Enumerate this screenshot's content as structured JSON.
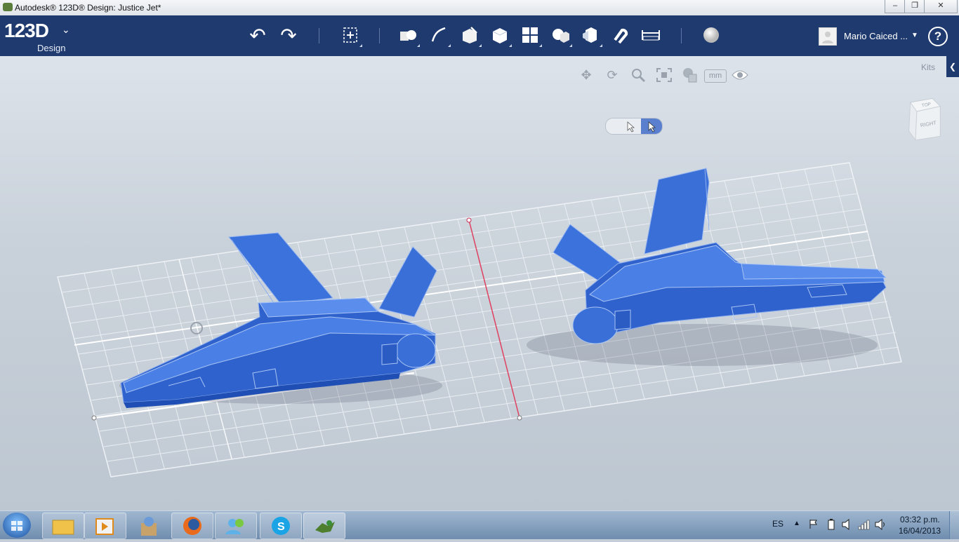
{
  "window": {
    "title": "Autodesk® 123D® Design: Justice Jet*",
    "controls": [
      "–",
      "❐",
      "✕"
    ]
  },
  "toolbar": {
    "logo_main": "123D",
    "logo_sub": "Design",
    "logo_chevron": "⌄",
    "undo_icon": "↶",
    "redo_icon": "↷",
    "user_name": "Mario Caiced ...",
    "user_dropdown": "▼",
    "help": "?"
  },
  "viewport": {
    "units": "mm",
    "kits_label": "Kits",
    "kits_tab_icon": "❮",
    "viewcube_top": "TOP",
    "viewcube_right": "RIGHT",
    "colors": {
      "model": "#3a6fd8",
      "model_dark": "#1f4fb4",
      "axis_red": "#e04060"
    }
  },
  "taskbar": {
    "language": "ES",
    "time": "03:32 p.m.",
    "date": "16/04/2013"
  }
}
